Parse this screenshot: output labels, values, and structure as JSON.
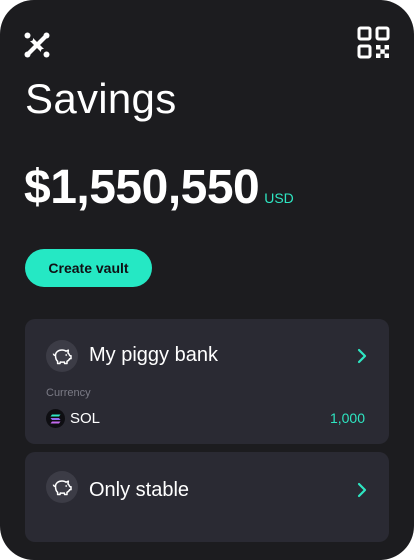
{
  "header": {
    "logo_icon": "x-logo-icon",
    "qr_icon": "qr-code-icon"
  },
  "page": {
    "title": "Savings"
  },
  "balance": {
    "amount": "$1,550,550",
    "currency": "USD"
  },
  "actions": {
    "create_vault_label": "Create vault"
  },
  "vaults": [
    {
      "name": "My piggy bank",
      "icon": "piggy-bank-icon",
      "currency_label": "Currency",
      "token_symbol": "SOL",
      "token_icon": "solana-icon",
      "token_amount": "1,000"
    },
    {
      "name": "Only stable",
      "icon": "piggy-bank-icon"
    }
  ],
  "colors": {
    "background": "#1c1c1f",
    "card": "#2a2a33",
    "accent": "#25e8c4",
    "muted_text": "#7b7b86"
  }
}
